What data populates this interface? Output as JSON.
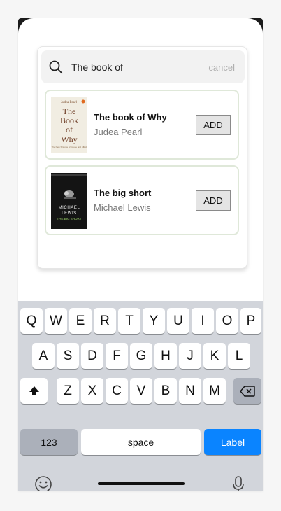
{
  "search": {
    "query": "The book of",
    "cancel_label": "cancel"
  },
  "results": [
    {
      "title": "The book of Why",
      "author": "Judea Pearl",
      "add_label": "ADD",
      "cover": {
        "top_text": "Judea Pearl",
        "line1": "The",
        "line2": "Book",
        "line3": "of",
        "line4": "Why",
        "sub": "The New Science of Cause and Effect"
      }
    },
    {
      "title": "The big short",
      "author": "Michael Lewis",
      "add_label": "ADD",
      "cover": {
        "author_line1": "MICHAEL",
        "author_line2": "LEWIS",
        "title_line": "THE BIG SHORT"
      }
    }
  ],
  "keyboard": {
    "row1": [
      "Q",
      "W",
      "E",
      "R",
      "T",
      "Y",
      "U",
      "I",
      "O",
      "P"
    ],
    "row2": [
      "A",
      "S",
      "D",
      "F",
      "G",
      "H",
      "J",
      "K",
      "L"
    ],
    "row3": [
      "Z",
      "X",
      "C",
      "V",
      "B",
      "N",
      "M"
    ],
    "numbers_label": "123",
    "space_label": "space",
    "return_label": "Label"
  },
  "colors": {
    "accent": "#0a84ff",
    "result_border": "#dfe8d9",
    "keyboard_bg": "#d2d5db"
  }
}
